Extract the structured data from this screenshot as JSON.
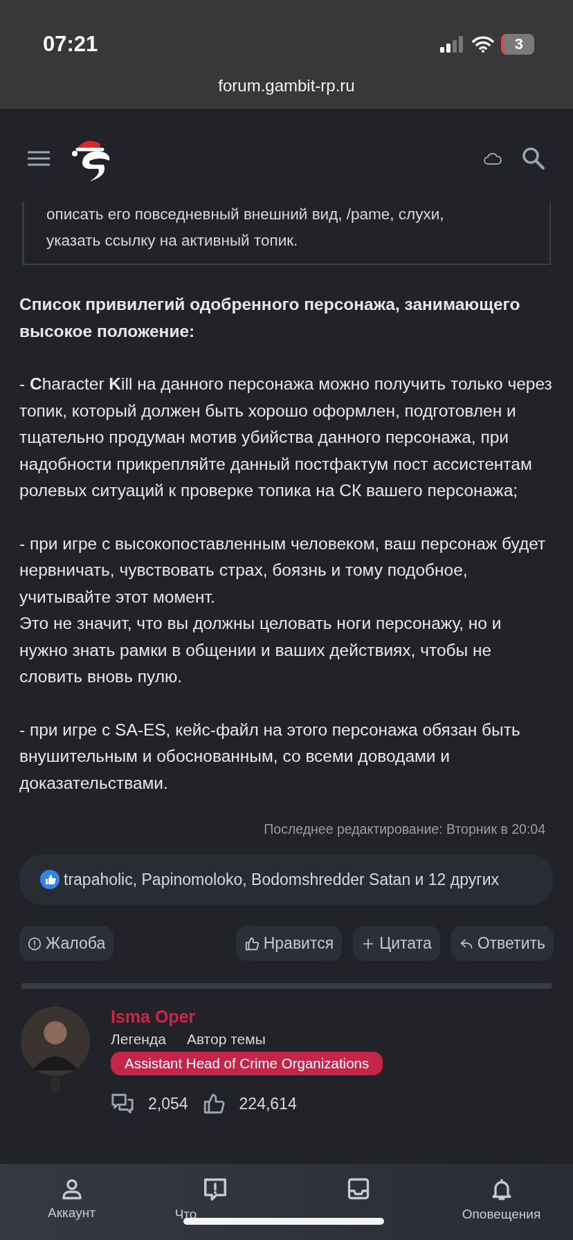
{
  "status_bar": {
    "time": "07:21",
    "battery": "3"
  },
  "url": "forum.gambit-rp.ru",
  "quote": {
    "lines": [
      "описать его повседневный внешний вид, /pame, слухи,",
      "указать ссылку на активный топик."
    ]
  },
  "paragraphs": [
    {
      "kind": "heading",
      "lines": [
        "Список привилегий одобренного персонажа, занимающего высокое положение:"
      ]
    },
    {
      "kind": "text",
      "lines": [
        "- **C**haracter **K**ill на данного персонажа можно получить только через топик, который должен быть хорошо оформлен, подготовлен и тщательно продуман мотив убийства данного персонажа, при надобности прикрепляйте данный постфактум пост ассистентам ролевых ситуаций к проверке топика на СК вашего персонажа;"
      ]
    },
    {
      "kind": "text",
      "lines": [
        "- при игре с высокопоставленным человеком, ваш персонаж будет нервничать, чувствовать страх, боязнь и тому подобное, учитывайте этот момент.",
        "Это не значит, что вы должны целовать ноги персонажу, но и нужно знать рамки в общении и ваших действиях, чтобы не словить вновь пулю."
      ]
    },
    {
      "kind": "text",
      "lines": [
        "- при игре с SA-ES, кейс-файл на этого персонажа обязан быть внушительным и обоснованным, со всеми доводами и доказательствами."
      ]
    }
  ],
  "edited": "Последнее редактирование: Вторник в 20:04",
  "reactions": "trapaholic, Papinomoloko, Bodomshredder Satan и 12 других",
  "actions": [
    {
      "kind": "report",
      "label": "Жалоба"
    },
    {
      "kind": "like",
      "label": "Нравится"
    },
    {
      "kind": "quote",
      "label": "Цитата"
    },
    {
      "kind": "reply",
      "label": "Ответить"
    }
  ],
  "author": {
    "name": "Isma Oper",
    "rank": "Легенда",
    "role": "Автор темы",
    "badge": "Assistant Head of Crime Organizations",
    "messages": "2,054",
    "likes": "224,614"
  },
  "bottom_nav": [
    {
      "kind": "account",
      "label": "Аккаунт"
    },
    {
      "kind": "news",
      "label": "Что"
    },
    {
      "kind": "inbox"
    },
    {
      "kind": "alerts",
      "label": "Оповещения"
    }
  ]
}
